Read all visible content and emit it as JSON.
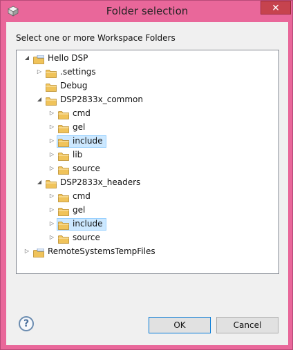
{
  "window": {
    "title": "Folder selection",
    "close_glyph": "✕"
  },
  "prompt": "Select one or more Workspace Folders",
  "tree": [
    {
      "label": "Hello DSP",
      "level": 0,
      "expanded": true,
      "has_children": true,
      "icon": "project-icon",
      "selected": false
    },
    {
      "label": ".settings",
      "level": 1,
      "expanded": false,
      "has_children": true,
      "icon": "folder-icon",
      "selected": false
    },
    {
      "label": "Debug",
      "level": 1,
      "expanded": false,
      "has_children": false,
      "icon": "folder-icon",
      "selected": false
    },
    {
      "label": "DSP2833x_common",
      "level": 1,
      "expanded": true,
      "has_children": true,
      "icon": "folder-icon",
      "selected": false
    },
    {
      "label": "cmd",
      "level": 2,
      "expanded": false,
      "has_children": true,
      "icon": "folder-icon",
      "selected": false
    },
    {
      "label": "gel",
      "level": 2,
      "expanded": false,
      "has_children": true,
      "icon": "folder-icon",
      "selected": false
    },
    {
      "label": "include",
      "level": 2,
      "expanded": false,
      "has_children": true,
      "icon": "folder-icon",
      "selected": true
    },
    {
      "label": "lib",
      "level": 2,
      "expanded": false,
      "has_children": true,
      "icon": "folder-icon",
      "selected": false
    },
    {
      "label": "source",
      "level": 2,
      "expanded": false,
      "has_children": true,
      "icon": "folder-icon",
      "selected": false
    },
    {
      "label": "DSP2833x_headers",
      "level": 1,
      "expanded": true,
      "has_children": true,
      "icon": "folder-icon",
      "selected": false
    },
    {
      "label": "cmd",
      "level": 2,
      "expanded": false,
      "has_children": true,
      "icon": "folder-icon",
      "selected": false
    },
    {
      "label": "gel",
      "level": 2,
      "expanded": false,
      "has_children": true,
      "icon": "folder-icon",
      "selected": false
    },
    {
      "label": "include",
      "level": 2,
      "expanded": false,
      "has_children": true,
      "icon": "folder-icon",
      "selected": true
    },
    {
      "label": "source",
      "level": 2,
      "expanded": false,
      "has_children": true,
      "icon": "folder-icon",
      "selected": false
    },
    {
      "label": "RemoteSystemsTempFiles",
      "level": 0,
      "expanded": false,
      "has_children": true,
      "icon": "project-icon",
      "selected": false
    }
  ],
  "buttons": {
    "help": "?",
    "ok": "OK",
    "cancel": "Cancel"
  },
  "colors": {
    "frame": "#e9679a",
    "selection": "#cce8ff",
    "folder": "#f0c35a"
  }
}
